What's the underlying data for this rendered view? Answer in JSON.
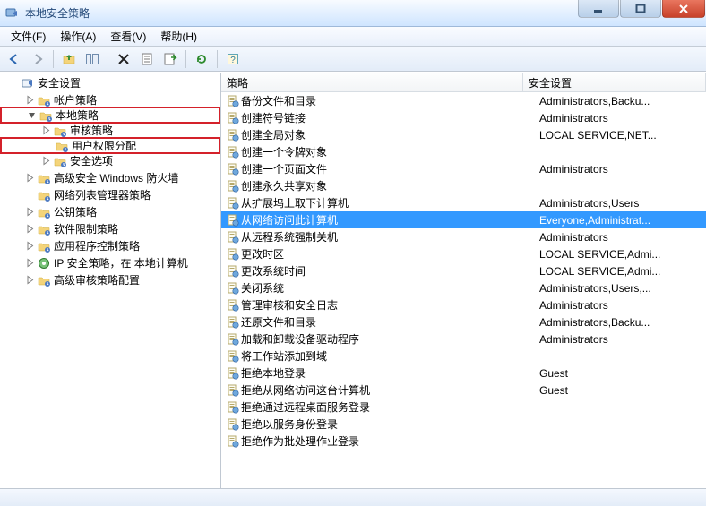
{
  "window": {
    "title": "本地安全策略"
  },
  "menu": {
    "file": "文件(F)",
    "action": "操作(A)",
    "view": "查看(V)",
    "help": "帮助(H)"
  },
  "list_header": {
    "policy": "策略",
    "setting": "安全设置"
  },
  "tree": [
    {
      "depth": 0,
      "expand": "none",
      "icon": "root",
      "label": "安全设置"
    },
    {
      "depth": 1,
      "expand": "closed",
      "icon": "folder",
      "label": "帐户策略"
    },
    {
      "depth": 1,
      "expand": "open",
      "icon": "folder",
      "label": "本地策略",
      "highlight": true
    },
    {
      "depth": 2,
      "expand": "closed",
      "icon": "folder",
      "label": "审核策略"
    },
    {
      "depth": 2,
      "expand": "none",
      "icon": "folder",
      "label": "用户权限分配",
      "highlight": true
    },
    {
      "depth": 2,
      "expand": "closed",
      "icon": "folder",
      "label": "安全选项"
    },
    {
      "depth": 1,
      "expand": "closed",
      "icon": "folder",
      "label": "高级安全 Windows 防火墙"
    },
    {
      "depth": 1,
      "expand": "none",
      "icon": "folder",
      "label": "网络列表管理器策略"
    },
    {
      "depth": 1,
      "expand": "closed",
      "icon": "folder",
      "label": "公钥策略"
    },
    {
      "depth": 1,
      "expand": "closed",
      "icon": "folder",
      "label": "软件限制策略"
    },
    {
      "depth": 1,
      "expand": "closed",
      "icon": "folder",
      "label": "应用程序控制策略"
    },
    {
      "depth": 1,
      "expand": "closed",
      "icon": "ip",
      "label": "IP 安全策略，在 本地计算机"
    },
    {
      "depth": 1,
      "expand": "closed",
      "icon": "folder",
      "label": "高级审核策略配置"
    }
  ],
  "list": [
    {
      "policy": "备份文件和目录",
      "setting": "Administrators,Backu..."
    },
    {
      "policy": "创建符号链接",
      "setting": "Administrators"
    },
    {
      "policy": "创建全局对象",
      "setting": "LOCAL SERVICE,NET..."
    },
    {
      "policy": "创建一个令牌对象",
      "setting": ""
    },
    {
      "policy": "创建一个页面文件",
      "setting": "Administrators"
    },
    {
      "policy": "创建永久共享对象",
      "setting": ""
    },
    {
      "policy": "从扩展坞上取下计算机",
      "setting": "Administrators,Users"
    },
    {
      "policy": "从网络访问此计算机",
      "setting": "Everyone,Administrat...",
      "selected": true
    },
    {
      "policy": "从远程系统强制关机",
      "setting": "Administrators"
    },
    {
      "policy": "更改时区",
      "setting": "LOCAL SERVICE,Admi..."
    },
    {
      "policy": "更改系统时间",
      "setting": "LOCAL SERVICE,Admi..."
    },
    {
      "policy": "关闭系统",
      "setting": "Administrators,Users,..."
    },
    {
      "policy": "管理审核和安全日志",
      "setting": "Administrators"
    },
    {
      "policy": "还原文件和目录",
      "setting": "Administrators,Backu..."
    },
    {
      "policy": "加载和卸载设备驱动程序",
      "setting": "Administrators"
    },
    {
      "policy": "将工作站添加到域",
      "setting": ""
    },
    {
      "policy": "拒绝本地登录",
      "setting": "Guest"
    },
    {
      "policy": "拒绝从网络访问这台计算机",
      "setting": "Guest"
    },
    {
      "policy": "拒绝通过远程桌面服务登录",
      "setting": ""
    },
    {
      "policy": "拒绝以服务身份登录",
      "setting": ""
    },
    {
      "policy": "拒绝作为批处理作业登录",
      "setting": ""
    }
  ]
}
